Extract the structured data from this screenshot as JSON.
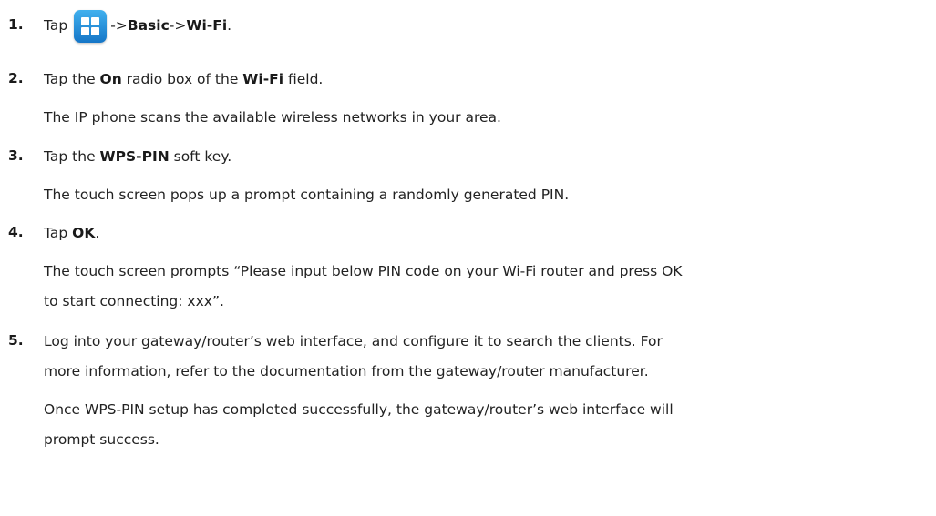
{
  "steps": [
    {
      "number": "1.",
      "pre": "Tap",
      "icon": "menu-grid-icon",
      "arrow1": "->",
      "bold1": "Basic",
      "arrow2": "->",
      "bold2": "Wi-Fi",
      "end": "."
    },
    {
      "number": "2.",
      "pre": "Tap the ",
      "bold1": "On",
      "mid": " radio box of the ",
      "bold2": "Wi-Fi",
      "end": " field.",
      "result": "The IP phone scans the available wireless networks in your area."
    },
    {
      "number": "3.",
      "pre": "Tap the ",
      "bold1": "WPS-PIN",
      "end": " soft key.",
      "result": "The touch screen pops up a prompt containing a randomly generated PIN."
    },
    {
      "number": "4.",
      "pre": "Tap ",
      "bold1": "OK",
      "end": ".",
      "result_line1": "The touch screen prompts “Please input below PIN code on your Wi-Fi router and press OK",
      "result_line2": "to start connecting: xxx”."
    },
    {
      "number": "5.",
      "line1": "Log into your gateway/router’s web interface, and configure it to search the clients. For",
      "line2": "more information, refer to the documentation from the gateway/router manufacturer.",
      "result_line1": "Once WPS-PIN setup has completed successfully, the gateway/router’s web interface will",
      "result_line2": "prompt success."
    }
  ]
}
